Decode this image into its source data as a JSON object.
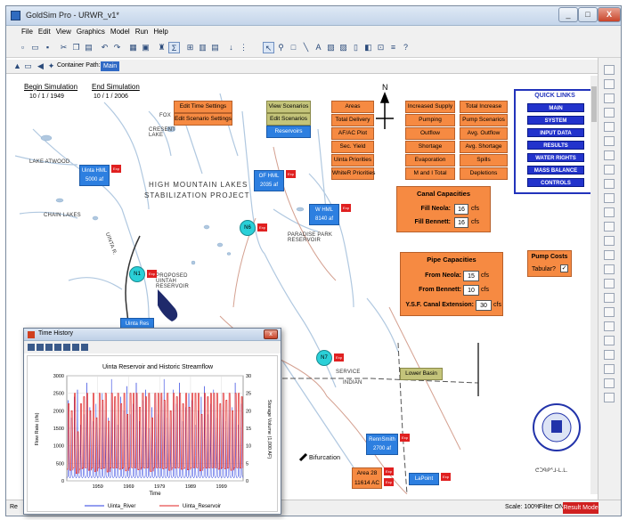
{
  "window": {
    "title": "GoldSim Pro - URWR_v1*",
    "controls": [
      "_",
      "□",
      "X"
    ]
  },
  "menu": [
    "File",
    "Edit",
    "View",
    "Graphics",
    "Model",
    "Run",
    "Help"
  ],
  "pathbar": {
    "label": "Container Path:",
    "value": "Main"
  },
  "simulation": {
    "begin_label": "Begin Simulation",
    "begin_date": "10 / 1 / 1949",
    "end_label": "End Simulation",
    "end_date": "10 / 1 / 2006"
  },
  "map_labels": {
    "lake_atwood": "LAKE ATWOOD",
    "chain_lakes": "CHAIN LAKES",
    "crescent_lake": "CRESENT LAKE",
    "fox": "FOX",
    "uinta_r": "UINTA R.",
    "proposed": "PROPOSED UINTAH RESERVOIR",
    "paradise": "PARADISE PARK RESERVOIR",
    "project_title_1": "HIGH MOUNTAIN LAKES",
    "project_title_2": "STABILIZATION PROJECT",
    "north": "N",
    "service": "SERVICE",
    "indian": "INDIAN",
    "bifurcation": "Bifurcation",
    "logo_text": "CENTRAL UTAH WATER CONSERVANCY DISTRICT",
    "consultant": "ᕦᑐᑫᑭᕐᒧ-ᒪ.ᒪ."
  },
  "top_buttons": {
    "time_settings": "Edit Time Settings",
    "scenario_settings": "Edit Scenario Settings",
    "view_scenarios": "View Scenarios",
    "edit_scenarios": "Edit Scenarios",
    "reservoirs": "Reservoirs",
    "lower_basin": "Lower Basin"
  },
  "result_buttons": {
    "col1": [
      "Areas",
      "Total Delivery",
      "AF/AC Plot",
      "Sec. Yield",
      "Uinta Priorities",
      "WhiteR Priorities"
    ],
    "col2": [
      "Increased Supply",
      "Pumping",
      "Outflow",
      "Shortage",
      "Evaporation",
      "M and I Total"
    ],
    "col3": [
      "Total Increase",
      "Pump Scenarios",
      "Avg. Outflow",
      "Avg. Shortage",
      "Spills",
      "Depletions"
    ]
  },
  "reservoirs": [
    {
      "name": "Uinta HML",
      "value": "5000 af"
    },
    {
      "name": "OF HML",
      "value": "2035 af"
    },
    {
      "name": "W HML",
      "value": "8140 af"
    },
    {
      "name": "Uinta Res",
      "value": ""
    },
    {
      "name": "RennSmith",
      "value": "2700 af"
    },
    {
      "name": "Area 28",
      "value": "11614 AC"
    },
    {
      "name": "LaPoint",
      "value": ""
    }
  ],
  "redtag_label": "Exp",
  "nodes": [
    "N1",
    "N6",
    "N7"
  ],
  "canal": {
    "title": "Canal Capacities",
    "rows": [
      {
        "label": "Fill Neola:",
        "value": "16",
        "unit": "cfs"
      },
      {
        "label": "Fill Bennett:",
        "value": "16",
        "unit": "cfs"
      }
    ]
  },
  "pipe": {
    "title": "Pipe Capacities",
    "rows": [
      {
        "label": "From Neola:",
        "value": "15",
        "unit": "cfs"
      },
      {
        "label": "From Bennett:",
        "value": "10",
        "unit": "cfs"
      },
      {
        "label": "Y.S.F. Canal Extension:",
        "value": "30",
        "unit": "cfs"
      }
    ]
  },
  "pump": {
    "title": "Pump Costs",
    "label": "Tabular?",
    "checked": "✓"
  },
  "quick_links": {
    "title": "QUICK LINKS",
    "items": [
      "MAIN",
      "SYSTEM",
      "INPUT DATA",
      "RESULTS",
      "WATER RIGHTS",
      "MASS BALANCE",
      "CONTROLS"
    ]
  },
  "status": {
    "left": "Re",
    "scale": "Scale: 100%",
    "filter": "Filter ON",
    "mode": "Result Mode"
  },
  "time_history": {
    "title": "Time History",
    "chart_title": "Uinta Reservoir and Historic Streamflow"
  },
  "chart_data": {
    "type": "line",
    "title": "Uinta Reservoir and Historic Streamflow",
    "xlabel": "Time",
    "ylabel": "Flow Rate (cfs)",
    "y2label": "Storage Volume (1,000 AF)",
    "xticks": [
      "1959",
      "1969",
      "1979",
      "1989",
      "1999"
    ],
    "yticks": [
      "0",
      "500",
      "1000",
      "1500",
      "2000",
      "2500",
      "3000"
    ],
    "y2ticks": [
      "0",
      "5",
      "10",
      "15",
      "20",
      "25",
      "30"
    ],
    "ylim": [
      0,
      3000
    ],
    "y2lim": [
      0,
      30
    ],
    "xlim": [
      1949,
      2006
    ],
    "series": [
      {
        "name": "Uinta_River",
        "color": "#2a3ee0",
        "axis": "left",
        "annual_peaks_cfs": [
          2300,
          1800,
          2400,
          2600,
          1600,
          1900,
          2800,
          2100,
          1700,
          2200,
          1500,
          2500,
          2000,
          1800,
          2900,
          2300,
          1600,
          2400,
          2000,
          2700,
          1900,
          2200,
          2800,
          1700,
          2300,
          2600,
          1500,
          2100,
          2500,
          1900,
          2400,
          2900,
          1800,
          2000,
          2600,
          2200,
          2800,
          1700,
          2100,
          2500,
          2300,
          1600,
          2000,
          2400,
          2700,
          1900,
          2200,
          2600,
          1800,
          2000,
          2500,
          1700,
          2300,
          2100,
          2800,
          1600,
          2200
        ]
      },
      {
        "name": "Uinta_Reservoir",
        "color": "#e02020",
        "axis": "right",
        "annual_max_kaf": [
          22,
          20,
          25,
          14,
          22,
          24,
          25,
          20,
          25,
          18,
          25,
          23,
          25,
          17,
          25,
          24,
          25,
          22,
          25,
          19,
          25,
          25,
          25,
          21,
          25,
          24,
          25,
          18,
          25,
          25,
          25,
          23,
          25,
          20,
          25,
          24,
          25,
          22,
          25,
          21,
          25,
          25,
          25,
          19,
          25,
          24,
          25,
          25,
          25,
          22,
          25,
          23,
          25,
          20,
          25,
          25,
          24
        ]
      }
    ],
    "legend": "bottom"
  }
}
